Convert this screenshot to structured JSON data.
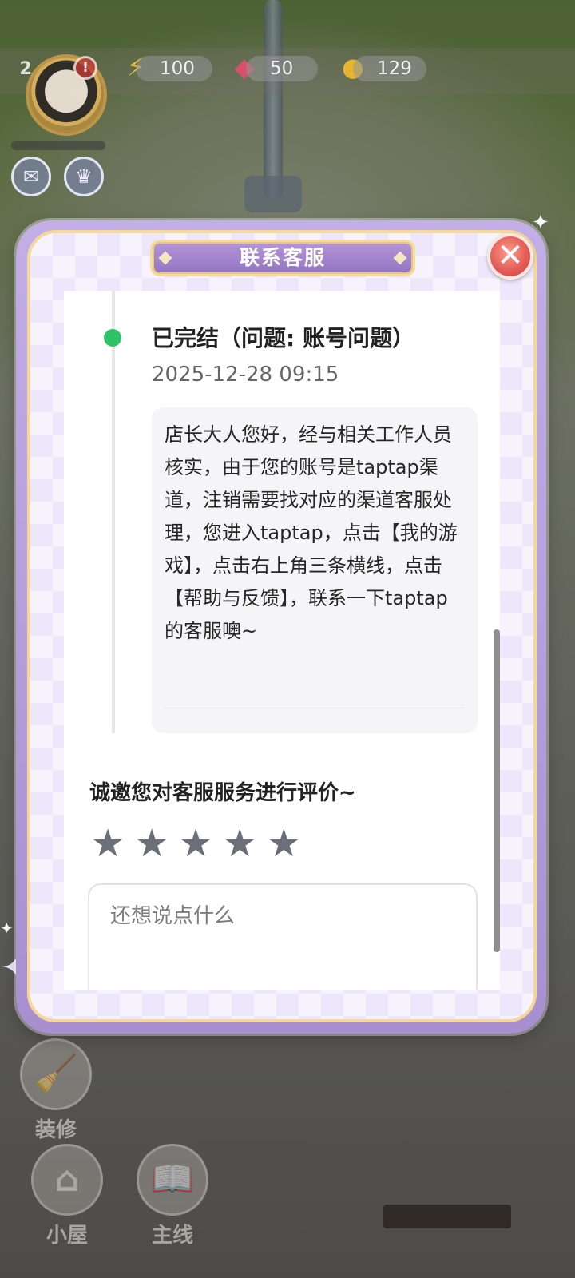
{
  "hud": {
    "level": "2",
    "energy": "100",
    "gems": "50",
    "coins": "129",
    "notification_badge": "!"
  },
  "dialog": {
    "title": "联系客服",
    "close_icon": "✕",
    "ticket": {
      "status_title": "已完结（问题: 账号问题）",
      "timestamp": "2025-12-28 09:15",
      "reply": "店长大人您好，经与相关工作人员核实，由于您的账号是taptap渠道，注销需要找对应的渠道客服处理，您进入taptap，点击【我的游戏】，点击右上角三条横线，点击【帮助与反馈】，联系一下taptap的客服噢~"
    },
    "rating": {
      "prompt": "诚邀您对客服服务进行评价~",
      "stars": [
        "★",
        "★",
        "★",
        "★",
        "★"
      ],
      "selected": 0,
      "comment_placeholder": "还想说点什么"
    }
  },
  "bottom_nav": {
    "decorate": "装修",
    "house": "小屋",
    "mainline": "主线"
  },
  "colors": {
    "status_green": "#2fc266",
    "dialog_purple": "#a88fcf",
    "close_red": "#e15a55",
    "star_gray": "#6b6f78"
  }
}
